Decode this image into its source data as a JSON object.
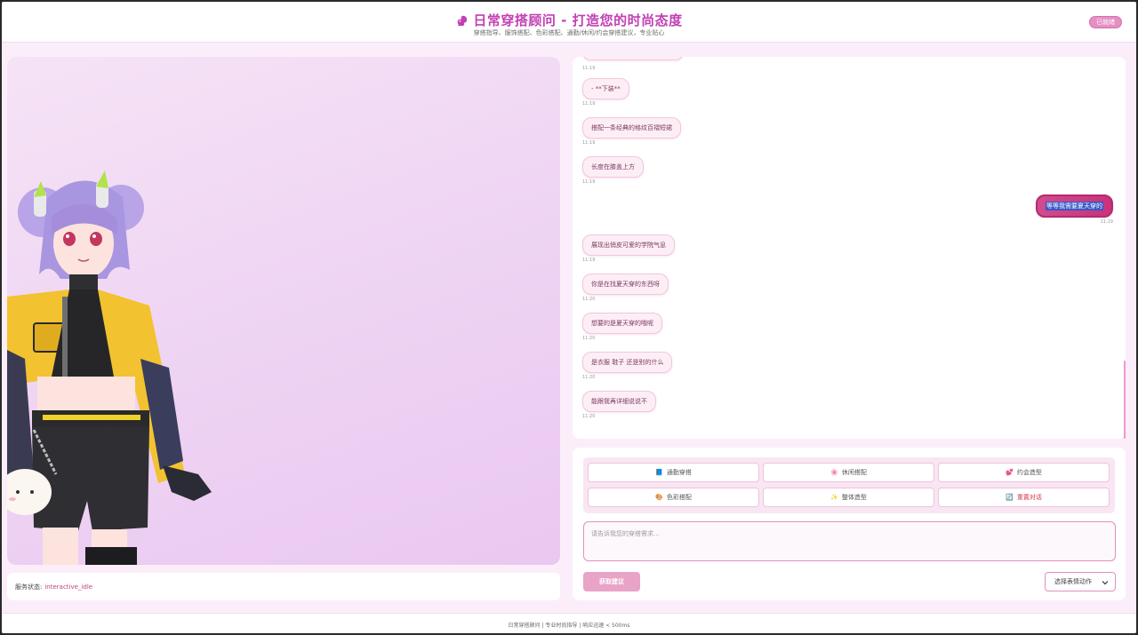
{
  "header": {
    "title": "日常穿搭顾问 - 打造您的时尚态度",
    "subtitle": "穿搭指导、服饰搭配、色彩搭配、通勤/休闲/约会穿搭建议，专业贴心",
    "status": "已就绪"
  },
  "service": {
    "label": "服务状态:",
    "value": "interactive_idle"
  },
  "messages": [
    {
      "role": "bot",
      "text": "- **下装**",
      "time": "11:19"
    },
    {
      "role": "bot",
      "text": "搭配一条经典的格纹百褶短裙",
      "time": "11:19"
    },
    {
      "role": "bot",
      "text": "长度在膝盖上方",
      "time": "11:19"
    },
    {
      "role": "user",
      "text": "等等我需要夏天穿的",
      "time": "11:19"
    },
    {
      "role": "bot",
      "text": "展现出俏皮可爱的学院气息",
      "time": "11:19"
    },
    {
      "role": "bot",
      "text": "你是在找夏天穿的东西呀",
      "time": "11:20"
    },
    {
      "role": "bot",
      "text": "想要的是夏天穿的哦呢",
      "time": "11:20"
    },
    {
      "role": "bot",
      "text": "是衣服 鞋子 还是别的什么",
      "time": "11:20"
    },
    {
      "role": "bot",
      "text": "能跟我再详细说说不",
      "time": "11:20"
    }
  ],
  "top_time": "11:19",
  "quick_actions": [
    {
      "icon": "📘",
      "label": "通勤穿搭"
    },
    {
      "icon": "🌸",
      "label": "休闲搭配"
    },
    {
      "icon": "💕",
      "label": "约会造型"
    },
    {
      "icon": "🎨",
      "label": "色彩搭配"
    },
    {
      "icon": "✨",
      "label": "整体造型"
    },
    {
      "icon": "🔄",
      "label": "重置对话"
    }
  ],
  "input": {
    "placeholder": "请告诉我您的穿搭需求..."
  },
  "submit_label": "获取建议",
  "select_label": "选择表情动作",
  "footer": "日常穿搭顾问 | 专业时尚指导 | 响应迅速 < 500ms",
  "colors": {
    "accent": "#c23fb4",
    "user_bubble": "#c8327a",
    "bot_bubble": "#fdeef6",
    "status_value": "#c2417f"
  }
}
